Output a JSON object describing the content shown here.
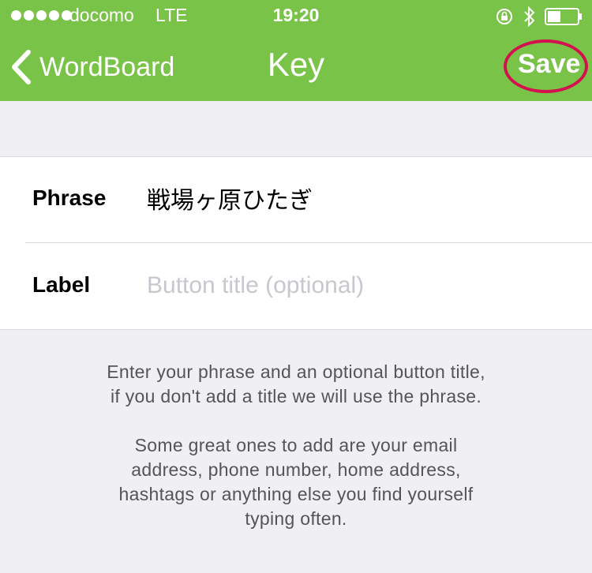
{
  "status_bar": {
    "carrier": "docomo",
    "network": "LTE",
    "time": "19:20"
  },
  "nav": {
    "back_label": "WordBoard",
    "title": "Key",
    "save_label": "Save"
  },
  "form": {
    "phrase": {
      "label": "Phrase",
      "value": "戦場ヶ原ひたぎ"
    },
    "label": {
      "label": "Label",
      "value": "",
      "placeholder": "Button title (optional)"
    }
  },
  "help": {
    "paragraph1": [
      "Enter your phrase and an optional button title,",
      "if you don't add a title we will use the phrase."
    ],
    "paragraph2": [
      "Some great ones to add are your email",
      "address, phone number, home address,",
      "hashtags or anything else you find yourself",
      "typing often."
    ]
  },
  "colors": {
    "bar": "#7ac349",
    "highlight": "#d3114f",
    "background": "#efeff4"
  }
}
